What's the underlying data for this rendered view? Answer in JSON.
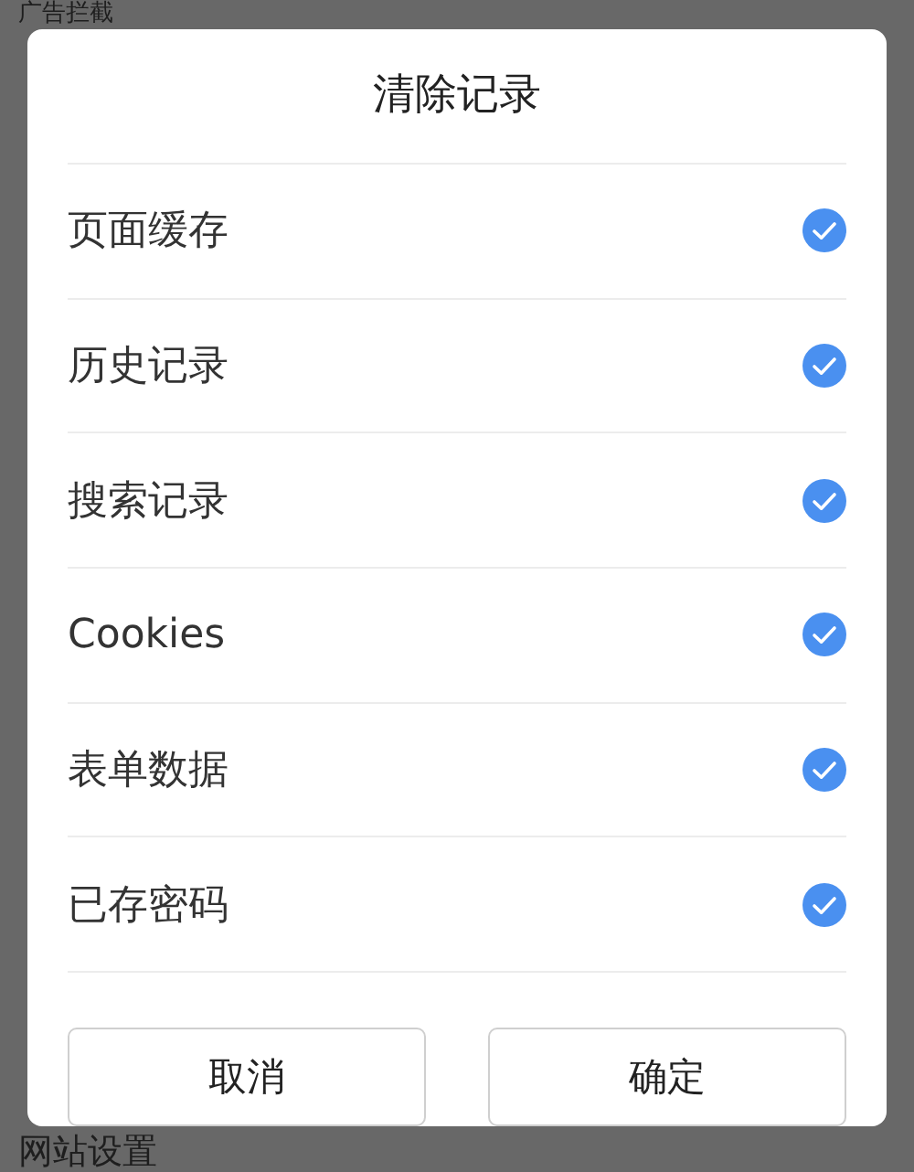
{
  "background": {
    "top_item": "广告拦截",
    "bottom_item": "网站设置"
  },
  "dialog": {
    "title": "清除记录",
    "items": [
      {
        "label": "页面缓存",
        "checked": true
      },
      {
        "label": "历史记录",
        "checked": true
      },
      {
        "label": "搜索记录",
        "checked": true
      },
      {
        "label": "Cookies",
        "checked": true
      },
      {
        "label": "表单数据",
        "checked": true
      },
      {
        "label": "已存密码",
        "checked": true
      }
    ],
    "buttons": [
      "取消",
      "确定"
    ]
  }
}
